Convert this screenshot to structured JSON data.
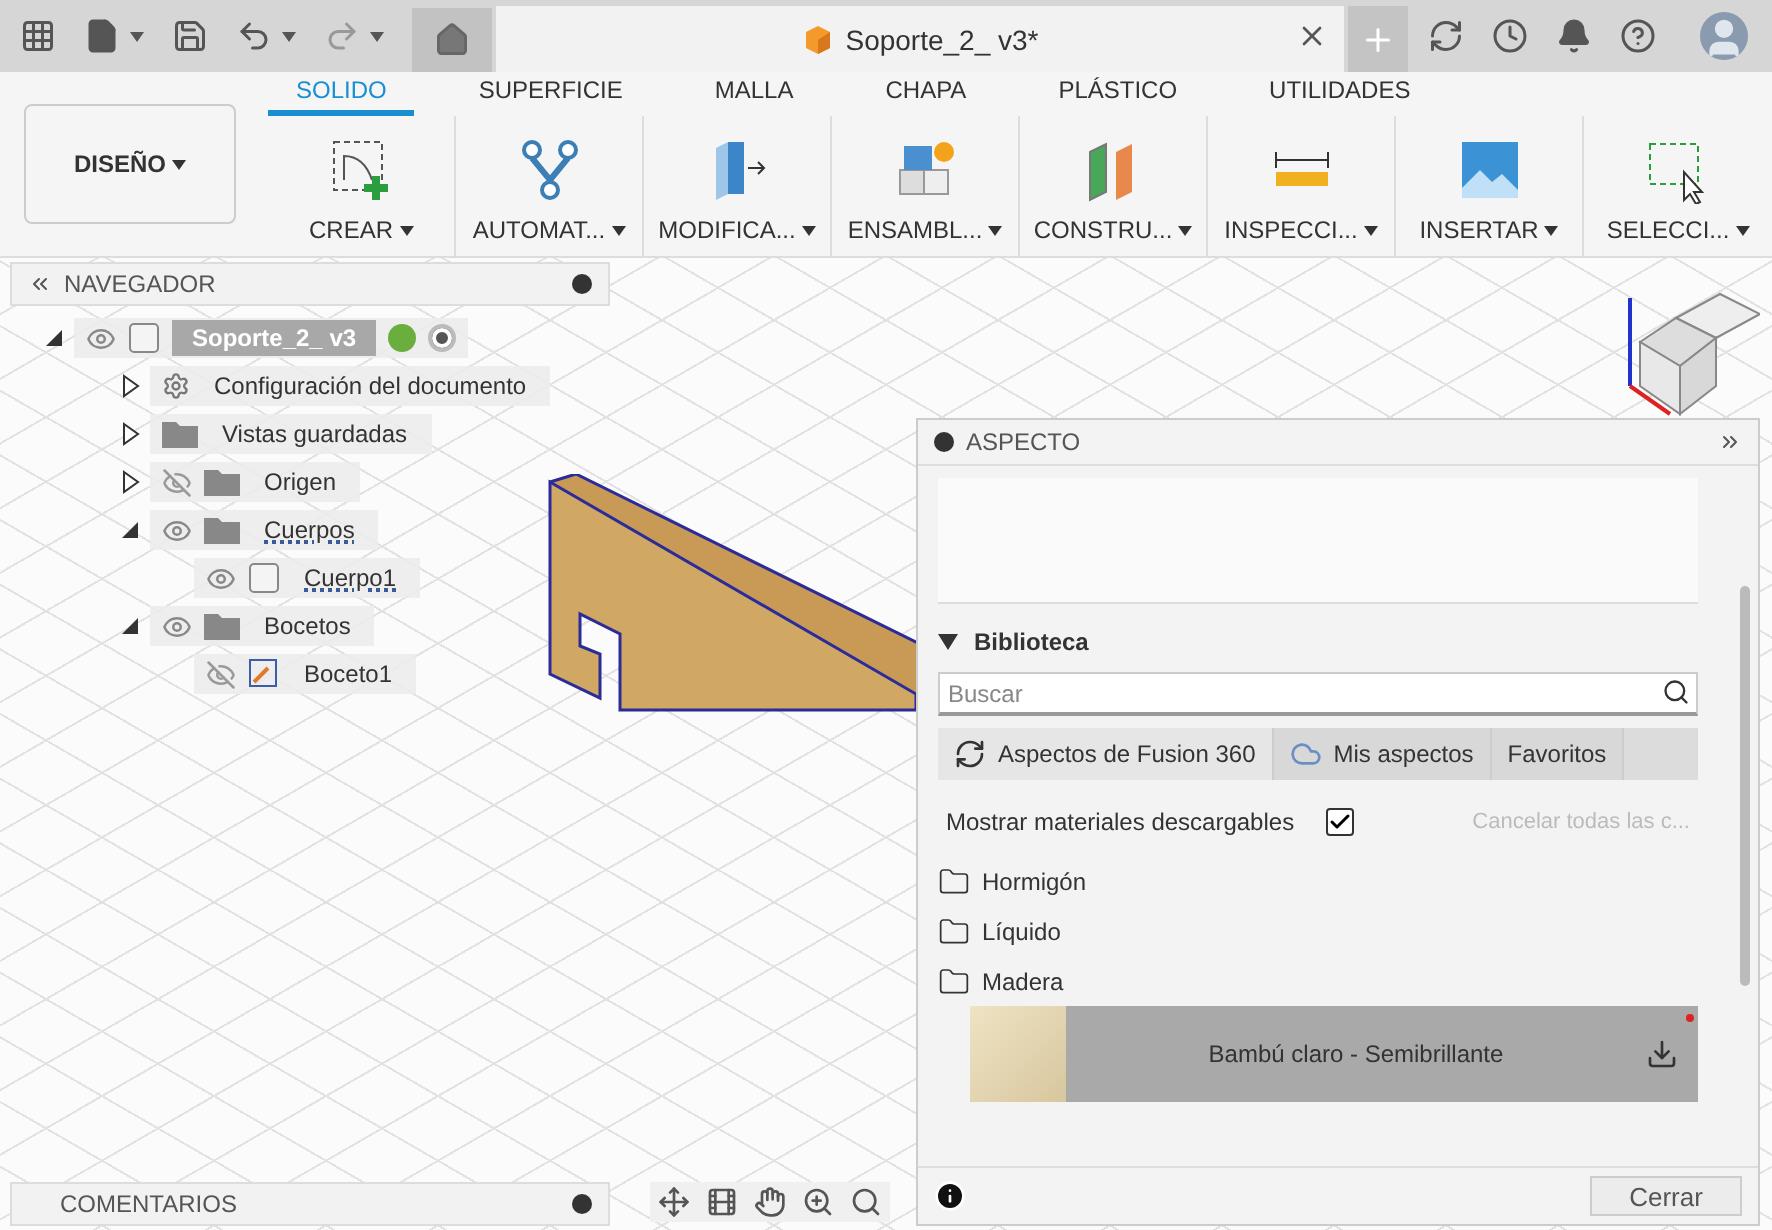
{
  "document_tab": {
    "title": "Soporte_2_ v3*"
  },
  "ribbon": {
    "workspace": "DISEÑO",
    "tabs": [
      {
        "label": "SOLIDO",
        "selected": true
      },
      {
        "label": "SUPERFICIE",
        "selected": false
      },
      {
        "label": "MALLA",
        "selected": false
      },
      {
        "label": "CHAPA",
        "selected": false
      },
      {
        "label": "PLÁSTICO",
        "selected": false
      },
      {
        "label": "UTILIDADES",
        "selected": false
      }
    ],
    "groups": [
      {
        "label": "CREAR",
        "kind": "create"
      },
      {
        "label": "AUTOMAT...",
        "kind": "automate"
      },
      {
        "label": "MODIFICA...",
        "kind": "modify"
      },
      {
        "label": "ENSAMBL...",
        "kind": "assemble"
      },
      {
        "label": "CONSTRU...",
        "kind": "construct"
      },
      {
        "label": "INSPECCI...",
        "kind": "inspect"
      },
      {
        "label": "INSERTAR",
        "kind": "insert"
      },
      {
        "label": "SELECCI...",
        "kind": "select"
      }
    ]
  },
  "browser": {
    "title": "NAVEGADOR",
    "root": {
      "label": "Soporte_2_ v3",
      "expanded": true
    },
    "items": [
      {
        "label": "Configuración del documento",
        "kind": "settings",
        "expanded": false
      },
      {
        "label": "Vistas guardadas",
        "kind": "folder",
        "expanded": false
      },
      {
        "label": "Origen",
        "kind": "folder",
        "expanded": false,
        "visible": false
      },
      {
        "label": "Cuerpos",
        "kind": "folder",
        "expanded": true,
        "visible": true,
        "children": [
          {
            "label": "Cuerpo1",
            "kind": "body",
            "visible": true
          }
        ]
      },
      {
        "label": "Bocetos",
        "kind": "folder",
        "expanded": true,
        "visible": true,
        "children": [
          {
            "label": "Boceto1",
            "kind": "sketch",
            "visible": false
          }
        ]
      }
    ]
  },
  "appearance_panel": {
    "title": "ASPECTO",
    "library": {
      "title": "Biblioteca",
      "expanded": true,
      "search": {
        "placeholder": "Buscar"
      },
      "tabs": [
        {
          "label": "Aspectos de Fusion 360",
          "kind": "sync",
          "selected": true
        },
        {
          "label": "Mis aspectos",
          "kind": "cloud",
          "selected": false
        },
        {
          "label": "Favoritos",
          "kind": "plain",
          "selected": false
        }
      ],
      "show_downloadable": {
        "label": "Mostrar materiales descargables",
        "checked": true
      },
      "cancel_link": {
        "label": "Cancelar todas las c...",
        "disabled": true
      },
      "folders": [
        "Hormigón",
        "Líquido",
        "Madera"
      ],
      "materials": [
        {
          "label": "Bambú claro - Semibrillante",
          "selected": true
        }
      ]
    },
    "close_button": "Cerrar"
  },
  "comments": {
    "title": "COMENTARIOS"
  }
}
